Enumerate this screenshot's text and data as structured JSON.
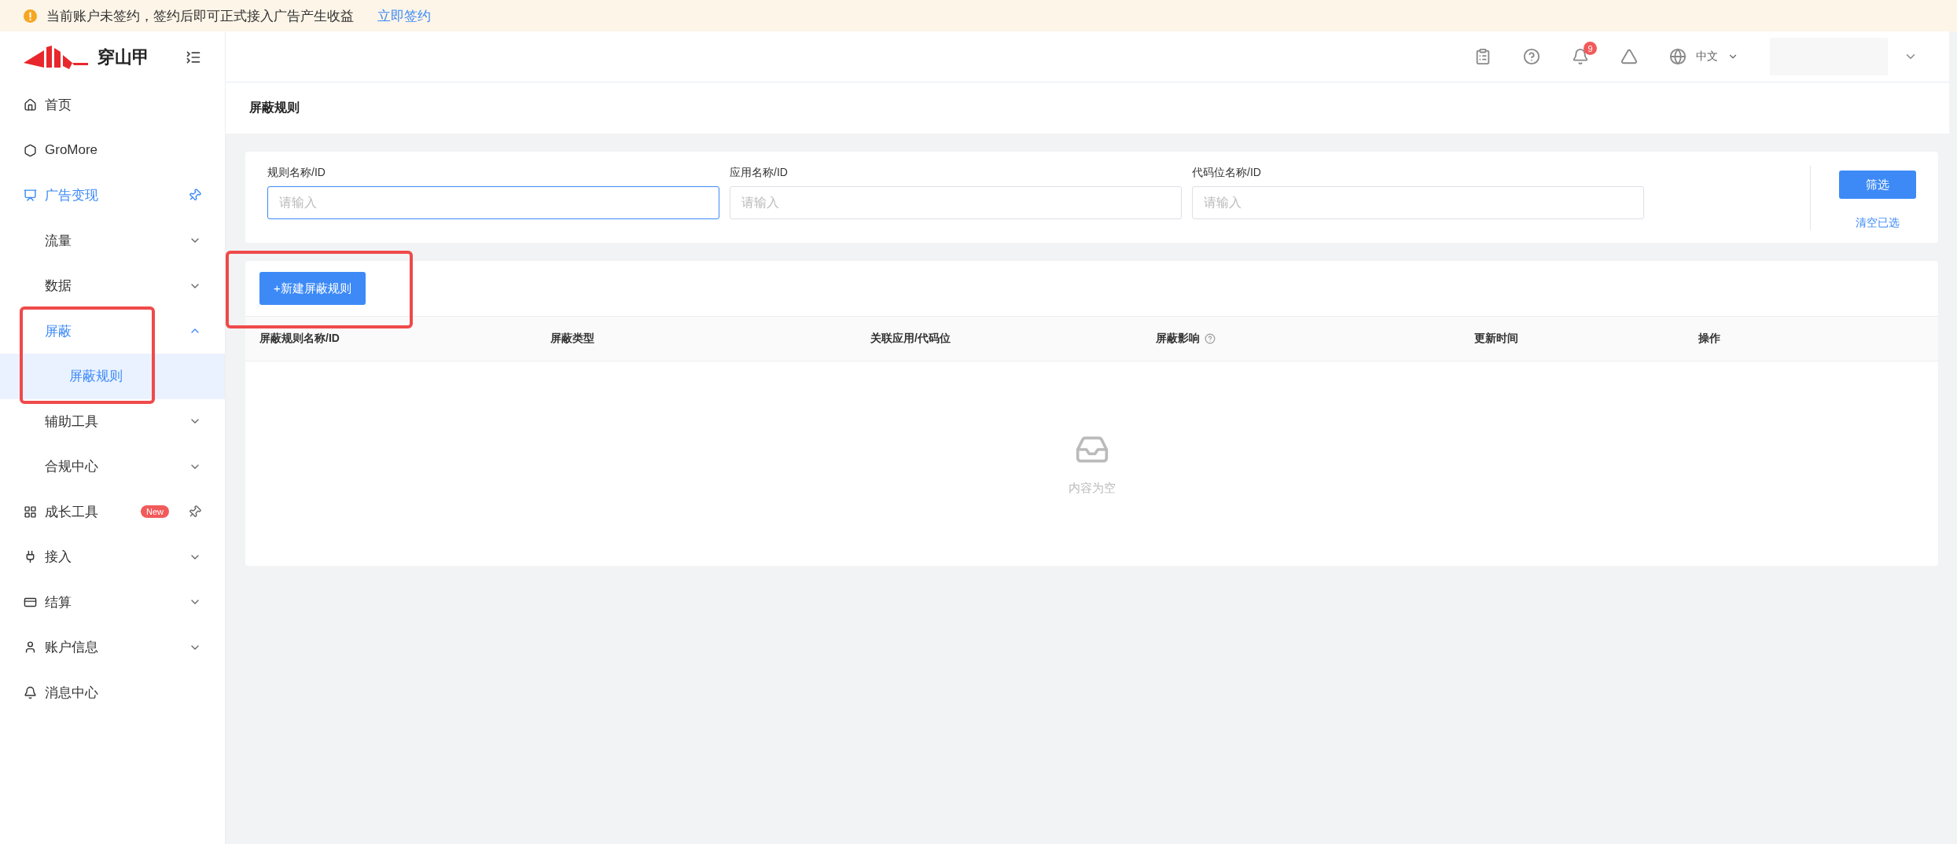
{
  "notice": {
    "text": "当前账户未签约，签约后即可正式接入广告产生收益",
    "link": "立即签约"
  },
  "logo": {
    "text": "穿山甲"
  },
  "sidebar": {
    "items": [
      {
        "label": "首页",
        "selected": false
      },
      {
        "label": "GroMore",
        "selected": false
      },
      {
        "label": "广告变现",
        "selected": true,
        "pinned": true,
        "expanded": true,
        "children": [
          {
            "label": "流量",
            "selected": false,
            "expanded": false
          },
          {
            "label": "数据",
            "selected": false,
            "expanded": false
          },
          {
            "label": "屏蔽",
            "selected": true,
            "expanded": true,
            "annotated": true,
            "children": [
              {
                "label": "屏蔽规则",
                "selected": true
              }
            ]
          },
          {
            "label": "辅助工具",
            "selected": false,
            "expanded": false
          },
          {
            "label": "合规中心",
            "selected": false,
            "expanded": false
          }
        ]
      },
      {
        "label": "成长工具",
        "selected": false,
        "pinned": true,
        "badge": "New"
      },
      {
        "label": "接入",
        "selected": false,
        "expanded": false
      },
      {
        "label": "结算",
        "selected": false,
        "expanded": false
      },
      {
        "label": "账户信息",
        "selected": false,
        "expanded": false
      },
      {
        "label": "消息中心",
        "selected": false
      }
    ]
  },
  "header": {
    "notification_count": "9",
    "language": "中文"
  },
  "page_title": "屏蔽规则",
  "filters": {
    "fields": [
      {
        "label": "规则名称/ID",
        "placeholder": "请输入",
        "focused": true
      },
      {
        "label": "应用名称/ID",
        "placeholder": "请输入",
        "focused": false
      },
      {
        "label": "代码位名称/ID",
        "placeholder": "请输入",
        "focused": false
      }
    ],
    "submit": "筛选",
    "clear": "清空已选"
  },
  "table": {
    "action": {
      "label": "+新建屏蔽规则",
      "annotated": true
    },
    "columns": [
      {
        "label": "屏蔽规则名称/ID",
        "help": false
      },
      {
        "label": "屏蔽类型",
        "help": false
      },
      {
        "label": "关联应用/代码位",
        "help": false
      },
      {
        "label": "屏蔽影响",
        "help": true
      },
      {
        "label": "更新时间",
        "help": false
      },
      {
        "label": "操作",
        "help": false
      }
    ],
    "empty_text": "内容为空"
  }
}
